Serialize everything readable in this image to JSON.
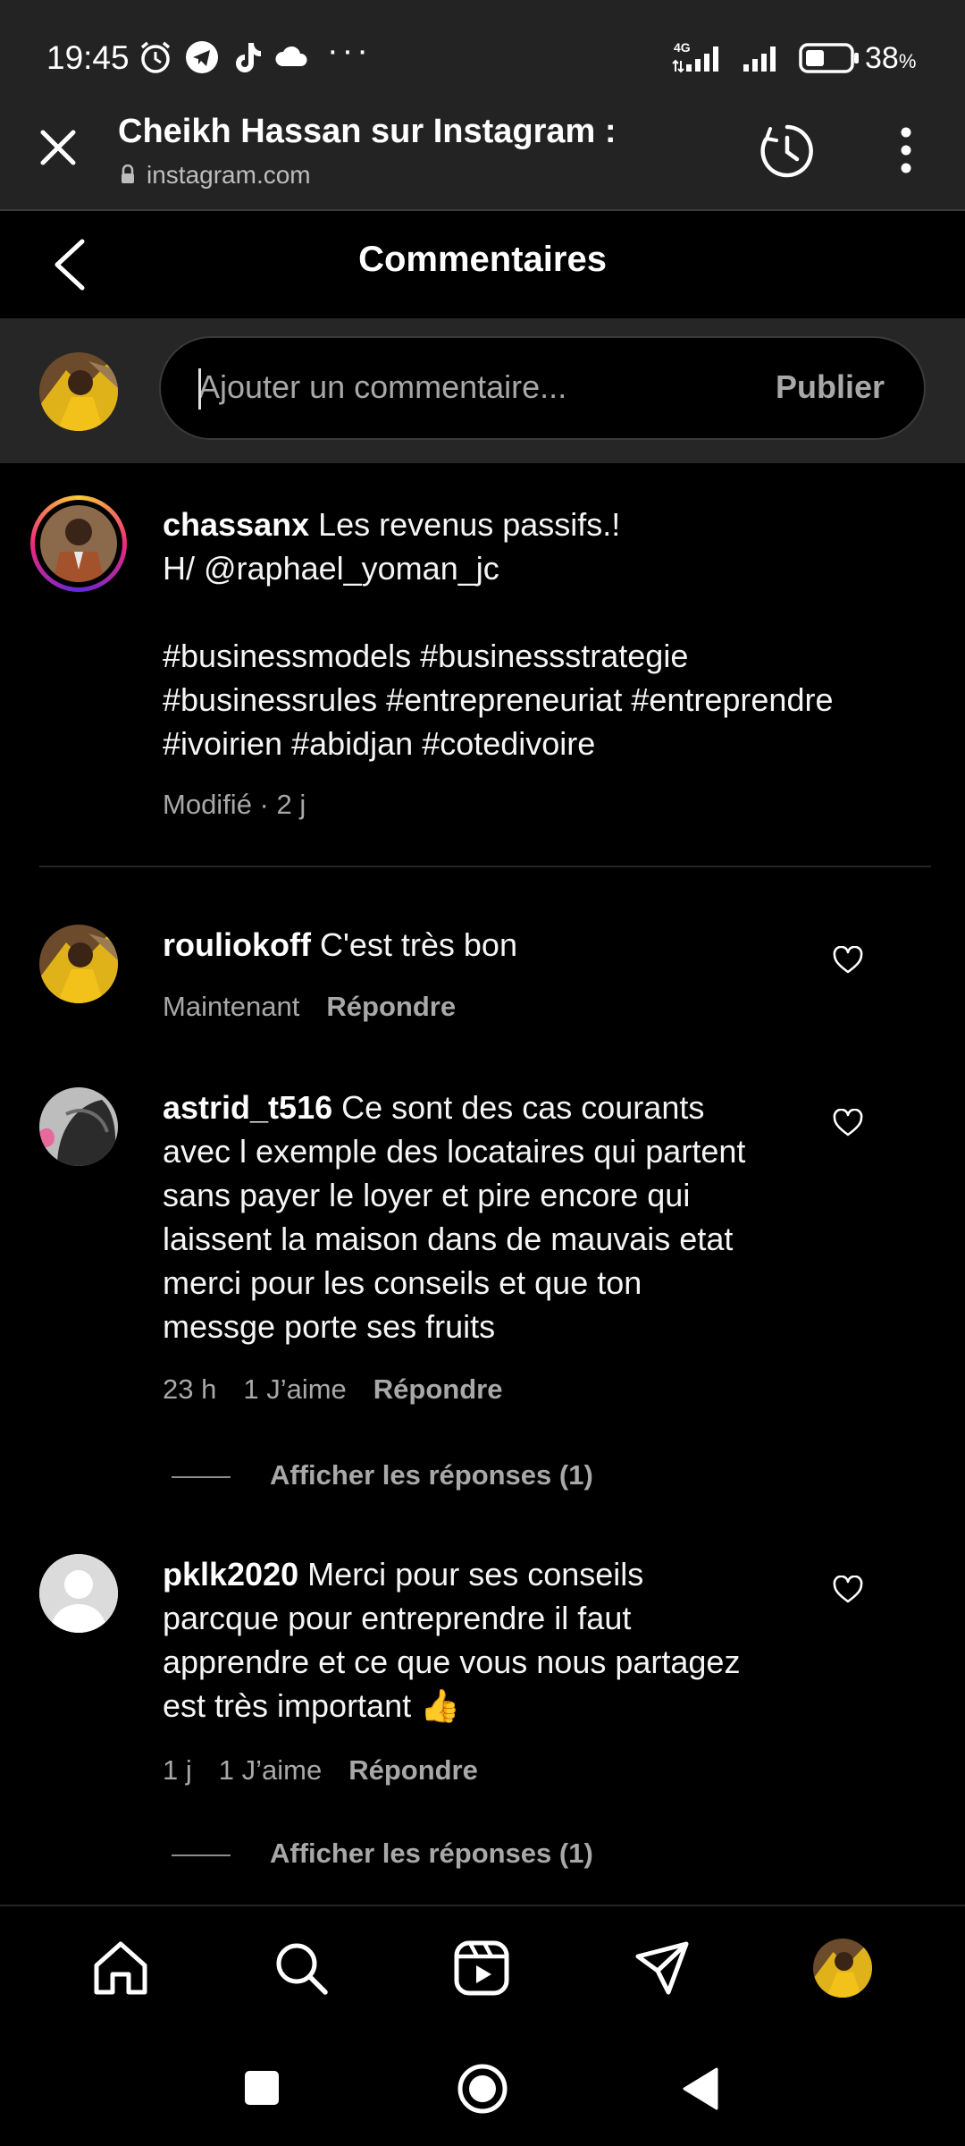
{
  "status_bar": {
    "time": "19:45",
    "network_label": "4G",
    "battery": "38",
    "battery_unit": "%",
    "icons": [
      "alarm-icon",
      "telegram-icon",
      "tiktok-icon",
      "cloud-icon",
      "more-dots-icon",
      "signal-icon",
      "battery-icon"
    ]
  },
  "toolbar": {
    "title": "Cheikh Hassan sur Instagram :",
    "url": "instagram.com"
  },
  "header": {
    "title": "Commentaires"
  },
  "composer": {
    "placeholder": "Ajouter un commentaire...",
    "publish_label": "Publier"
  },
  "caption": {
    "username": "chassanx",
    "lines": [
      "Les revenus passifs.!",
      "H/ @raphael_yoman_jc",
      "",
      "#businessmodels #businessstrategie",
      "#businessrules #entrepreneuriat #entreprendre",
      "#ivoirien #abidjan #cotedivoire"
    ],
    "meta": "Modifié · 2 j"
  },
  "comments": [
    {
      "username": "rouliokoff",
      "lines": [
        "C'est très bon"
      ],
      "time": "Maintenant",
      "likes": "",
      "reply_label": "Répondre"
    },
    {
      "username": "astrid_t516",
      "lines": [
        "Ce sont des cas courants",
        "avec l exemple des locataires qui partent",
        "sans payer le loyer et pire encore qui",
        "laissent la maison dans de mauvais etat",
        "merci pour les conseils et que ton",
        "messge porte ses fruits"
      ],
      "time": "23 h",
      "likes": "1 J’aime",
      "reply_label": "Répondre",
      "view_replies": "Afficher les réponses (1)"
    },
    {
      "username": "pklk2020",
      "lines": [
        "Merci pour ses conseils",
        "parcque pour entreprendre il faut",
        "apprendre et ce que vous nous partagez",
        "est très important 👍"
      ],
      "time": "1 j",
      "likes": "1 J’aime",
      "reply_label": "Répondre",
      "view_replies": "Afficher les réponses (1)"
    }
  ],
  "colors": {
    "background": "#000000",
    "chrome": "#232323",
    "muted_text": "#a8a8a8",
    "story_ring_start": "#f9ce34",
    "story_ring_mid": "#ee2a7b",
    "story_ring_end": "#6228d7",
    "thumbs_up": "#f5c518"
  }
}
